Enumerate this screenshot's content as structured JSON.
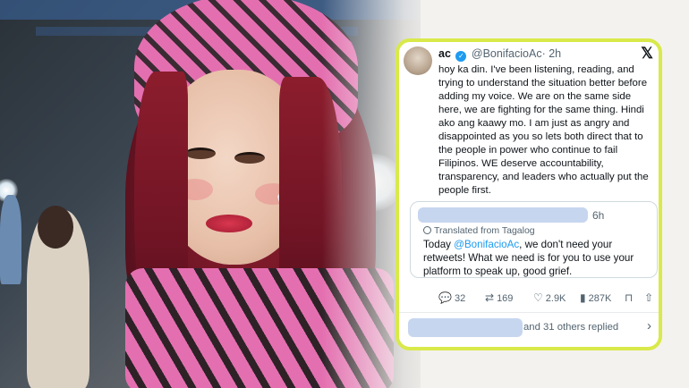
{
  "tweet": {
    "name": "ac",
    "handle": "@BonifacioAc",
    "time": "· 2h",
    "text": "hoy ka din. I've been listening, reading, and trying to understand the situation better before adding my voice. We are on the same side here, we are fighting for the same thing. Hindi ako ang kaawy mo. I am just as angry and disappointed as you so lets both direct that to the people in power who continue to fail Filipinos. WE deserve accountability, transparency, and leaders who actually put the people first.",
    "logo_icon": "x-logo-icon",
    "verified_icon": "verified-badge-icon"
  },
  "quote": {
    "time": "6h",
    "translated_label": "Translated from Tagalog",
    "text_before": "Today ",
    "mention": "@BonifacioAc",
    "text_after": ", we don't need your retweets! What we need is for you to use your platform to speak up, good grief."
  },
  "actions": {
    "replies": "32",
    "reposts": "169",
    "likes": "2.9K",
    "views": "287K"
  },
  "footer": {
    "replies_text": "and 31 others replied"
  },
  "colors": {
    "card_border": "#d9e94a",
    "link": "#1d9bf0",
    "redaction": "#c7d6ef",
    "hair": "#8c1d2d",
    "hood_pink": "#e46fb0"
  }
}
